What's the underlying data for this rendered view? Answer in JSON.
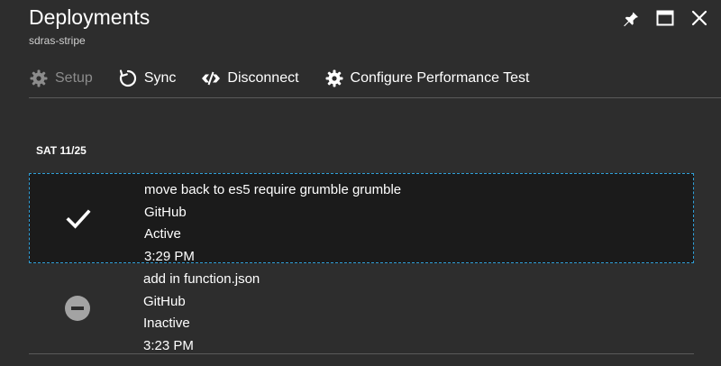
{
  "header": {
    "title": "Deployments",
    "subtitle": "sdras-stripe"
  },
  "window_controls": {
    "pin_icon": "pin-icon",
    "maximize_icon": "maximize-icon",
    "close_icon": "close-icon"
  },
  "toolbar": {
    "setup_label": "Setup",
    "sync_label": "Sync",
    "disconnect_label": "Disconnect",
    "perf_label": "Configure Performance Test"
  },
  "group": {
    "date_label": "SAT 11/25"
  },
  "deployments": [
    {
      "message": "move back to es5 require grumble grumble",
      "source": "GitHub",
      "state": "Active",
      "time": "3:29 PM",
      "status_icon": "checkmark-icon"
    },
    {
      "message": "add in function.json",
      "source": "GitHub",
      "state": "Inactive",
      "time": "3:23 PM",
      "status_icon": "minus-circle-icon"
    }
  ],
  "colors": {
    "background": "#2d2d2d",
    "selected_row": "#1b1b1b",
    "selection_border": "#2f9fd8",
    "disabled_text": "#8c8c8c"
  }
}
